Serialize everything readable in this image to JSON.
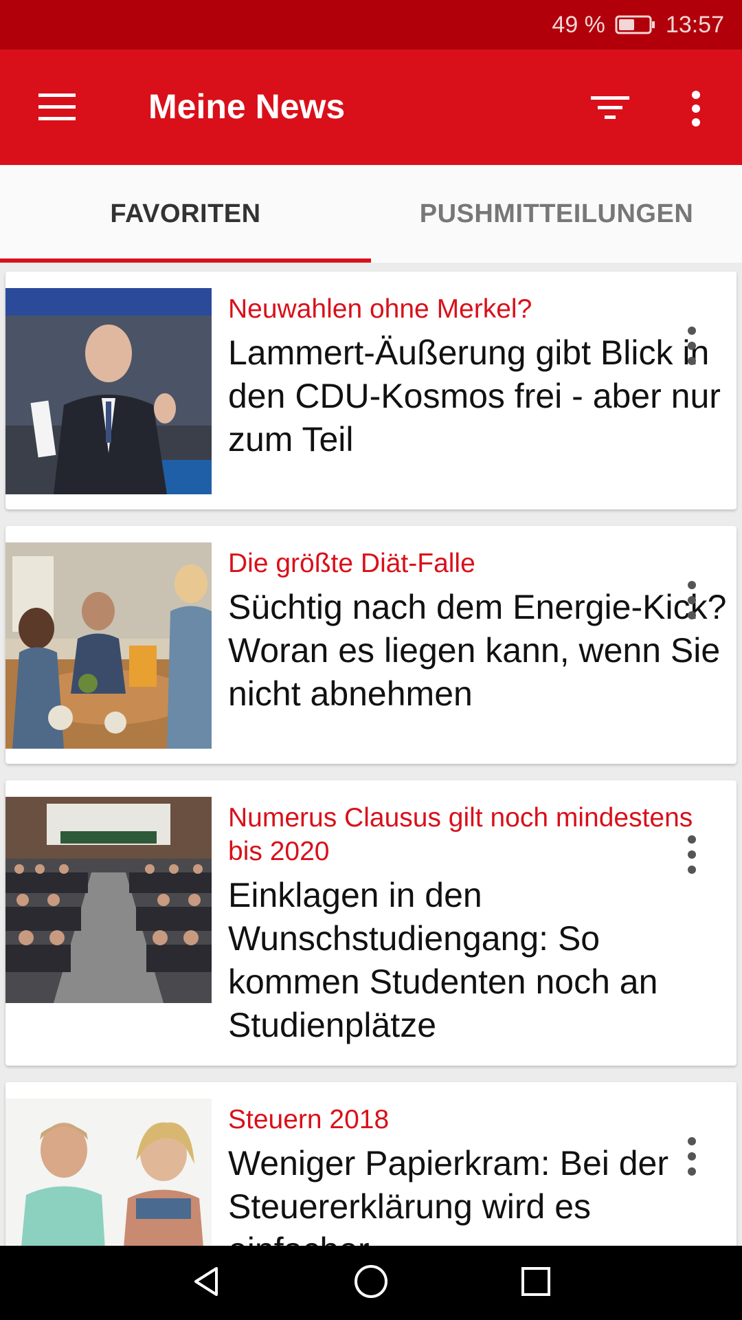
{
  "status_bar": {
    "battery_percent": "49 %",
    "time": "13:57",
    "battery_icon": "battery-icon"
  },
  "app_bar": {
    "title": "Meine News",
    "menu_icon": "menu-icon",
    "filter_icon": "filter-icon",
    "more_icon": "more-vert-icon"
  },
  "tabs": [
    {
      "label": "FAVORITEN",
      "active": true
    },
    {
      "label": "PUSHMITTEILUNGEN",
      "active": false
    }
  ],
  "articles": [
    {
      "kicker": "Neuwahlen ohne Merkel?",
      "headline": "Lammert-Äußerung gibt Blick in den CDU-Kosmos frei - aber nur zum Teil"
    },
    {
      "kicker": "Die größte Diät-Falle",
      "headline": "Süchtig nach dem Energie-Kick? Woran es liegen kann, wenn Sie nicht abnehmen"
    },
    {
      "kicker": "Numerus Clausus gilt noch mindestens bis 2020",
      "headline": "Einklagen in den Wunschstudiengang: So kommen Studenten noch an Studienplätze"
    },
    {
      "kicker": "Steuern 2018",
      "headline": "Weniger Papierkram: Bei der Steuererklärung wird es einfacher"
    }
  ],
  "colors": {
    "brand_red": "#d9101a",
    "status_bar": "#b1000a"
  },
  "nav_bar": {
    "back_icon": "back-icon",
    "home_icon": "home-icon",
    "recents_icon": "recents-icon"
  }
}
